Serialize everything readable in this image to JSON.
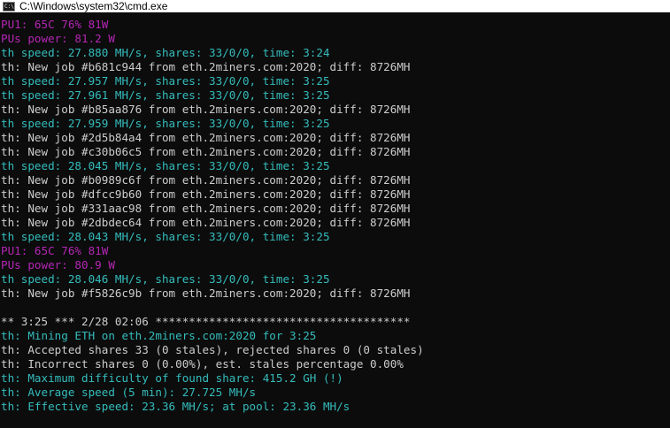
{
  "window": {
    "title": "C:\\Windows\\system32\\cmd.exe",
    "icon": "cmd-icon",
    "icon_glyph": "C:\\",
    "colors": {
      "background": "#0c0c0c",
      "titlebar": "#ffffff",
      "gpu_text": "#b426b4",
      "eth_text": "#35bcbc",
      "default_text": "#cccccc"
    }
  },
  "console": {
    "lines": [
      {
        "text": "PU1: 65C 76% 81W",
        "kind": "gpu"
      },
      {
        "text": "PUs power: 81.2 W",
        "kind": "gpu"
      },
      {
        "text": "th speed: 27.880 MH/s, shares: 33/0/0, time: 3:24",
        "kind": "eth"
      },
      {
        "text": "th: New job #b681c944 from eth.2miners.com:2020; diff: 8726MH",
        "kind": "info"
      },
      {
        "text": "th speed: 27.957 MH/s, shares: 33/0/0, time: 3:25",
        "kind": "eth"
      },
      {
        "text": "th speed: 27.961 MH/s, shares: 33/0/0, time: 3:25",
        "kind": "eth"
      },
      {
        "text": "th: New job #b85aa876 from eth.2miners.com:2020; diff: 8726MH",
        "kind": "info"
      },
      {
        "text": "th speed: 27.959 MH/s, shares: 33/0/0, time: 3:25",
        "kind": "eth"
      },
      {
        "text": "th: New job #2d5b84a4 from eth.2miners.com:2020; diff: 8726MH",
        "kind": "info"
      },
      {
        "text": "th: New job #c30b06c5 from eth.2miners.com:2020; diff: 8726MH",
        "kind": "info"
      },
      {
        "text": "th speed: 28.045 MH/s, shares: 33/0/0, time: 3:25",
        "kind": "eth"
      },
      {
        "text": "th: New job #b0989c6f from eth.2miners.com:2020; diff: 8726MH",
        "kind": "info"
      },
      {
        "text": "th: New job #dfcc9b60 from eth.2miners.com:2020; diff: 8726MH",
        "kind": "info"
      },
      {
        "text": "th: New job #331aac98 from eth.2miners.com:2020; diff: 8726MH",
        "kind": "info"
      },
      {
        "text": "th: New job #2dbdec64 from eth.2miners.com:2020; diff: 8726MH",
        "kind": "info"
      },
      {
        "text": "th speed: 28.043 MH/s, shares: 33/0/0, time: 3:25",
        "kind": "eth"
      },
      {
        "text": "PU1: 65C 76% 81W",
        "kind": "gpu"
      },
      {
        "text": "PUs power: 80.9 W",
        "kind": "gpu"
      },
      {
        "text": "th speed: 28.046 MH/s, shares: 33/0/0, time: 3:25",
        "kind": "eth"
      },
      {
        "text": "th: New job #f5826c9b from eth.2miners.com:2020; diff: 8726MH",
        "kind": "info"
      },
      {
        "text": "",
        "kind": "blank"
      },
      {
        "text": "** 3:25 *** 2/28 02:06 **************************************",
        "kind": "info"
      },
      {
        "text": "th: Mining ETH on eth.2miners.com:2020 for 3:25",
        "kind": "eth"
      },
      {
        "text": "th: Accepted shares 33 (0 stales), rejected shares 0 (0 stales)",
        "kind": "info"
      },
      {
        "text": "th: Incorrect shares 0 (0.00%), est. stales percentage 0.00%",
        "kind": "info"
      },
      {
        "text": "th: Maximum difficulty of found share: 415.2 GH (!)",
        "kind": "eth"
      },
      {
        "text": "th: Average speed (5 min): 27.725 MH/s",
        "kind": "eth"
      },
      {
        "text": "th: Effective speed: 23.36 MH/s; at pool: 23.36 MH/s",
        "kind": "eth"
      }
    ]
  }
}
